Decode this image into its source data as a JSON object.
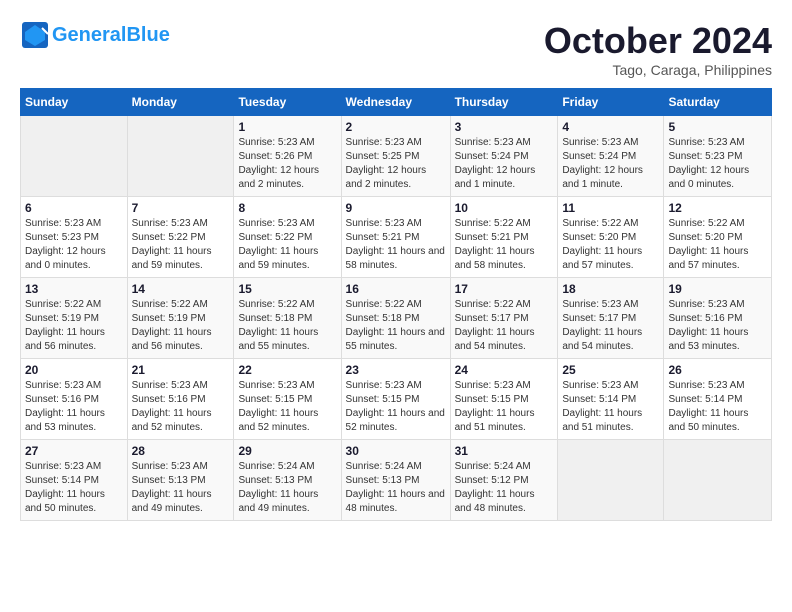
{
  "header": {
    "logo_text_part1": "General",
    "logo_text_part2": "Blue",
    "month": "October 2024",
    "location": "Tago, Caraga, Philippines"
  },
  "columns": [
    "Sunday",
    "Monday",
    "Tuesday",
    "Wednesday",
    "Thursday",
    "Friday",
    "Saturday"
  ],
  "weeks": [
    [
      {
        "day": "",
        "info": ""
      },
      {
        "day": "",
        "info": ""
      },
      {
        "day": "1",
        "info": "Sunrise: 5:23 AM\nSunset: 5:26 PM\nDaylight: 12 hours and 2 minutes."
      },
      {
        "day": "2",
        "info": "Sunrise: 5:23 AM\nSunset: 5:25 PM\nDaylight: 12 hours and 2 minutes."
      },
      {
        "day": "3",
        "info": "Sunrise: 5:23 AM\nSunset: 5:24 PM\nDaylight: 12 hours and 1 minute."
      },
      {
        "day": "4",
        "info": "Sunrise: 5:23 AM\nSunset: 5:24 PM\nDaylight: 12 hours and 1 minute."
      },
      {
        "day": "5",
        "info": "Sunrise: 5:23 AM\nSunset: 5:23 PM\nDaylight: 12 hours and 0 minutes."
      }
    ],
    [
      {
        "day": "6",
        "info": "Sunrise: 5:23 AM\nSunset: 5:23 PM\nDaylight: 12 hours and 0 minutes."
      },
      {
        "day": "7",
        "info": "Sunrise: 5:23 AM\nSunset: 5:22 PM\nDaylight: 11 hours and 59 minutes."
      },
      {
        "day": "8",
        "info": "Sunrise: 5:23 AM\nSunset: 5:22 PM\nDaylight: 11 hours and 59 minutes."
      },
      {
        "day": "9",
        "info": "Sunrise: 5:23 AM\nSunset: 5:21 PM\nDaylight: 11 hours and 58 minutes."
      },
      {
        "day": "10",
        "info": "Sunrise: 5:22 AM\nSunset: 5:21 PM\nDaylight: 11 hours and 58 minutes."
      },
      {
        "day": "11",
        "info": "Sunrise: 5:22 AM\nSunset: 5:20 PM\nDaylight: 11 hours and 57 minutes."
      },
      {
        "day": "12",
        "info": "Sunrise: 5:22 AM\nSunset: 5:20 PM\nDaylight: 11 hours and 57 minutes."
      }
    ],
    [
      {
        "day": "13",
        "info": "Sunrise: 5:22 AM\nSunset: 5:19 PM\nDaylight: 11 hours and 56 minutes."
      },
      {
        "day": "14",
        "info": "Sunrise: 5:22 AM\nSunset: 5:19 PM\nDaylight: 11 hours and 56 minutes."
      },
      {
        "day": "15",
        "info": "Sunrise: 5:22 AM\nSunset: 5:18 PM\nDaylight: 11 hours and 55 minutes."
      },
      {
        "day": "16",
        "info": "Sunrise: 5:22 AM\nSunset: 5:18 PM\nDaylight: 11 hours and 55 minutes."
      },
      {
        "day": "17",
        "info": "Sunrise: 5:22 AM\nSunset: 5:17 PM\nDaylight: 11 hours and 54 minutes."
      },
      {
        "day": "18",
        "info": "Sunrise: 5:23 AM\nSunset: 5:17 PM\nDaylight: 11 hours and 54 minutes."
      },
      {
        "day": "19",
        "info": "Sunrise: 5:23 AM\nSunset: 5:16 PM\nDaylight: 11 hours and 53 minutes."
      }
    ],
    [
      {
        "day": "20",
        "info": "Sunrise: 5:23 AM\nSunset: 5:16 PM\nDaylight: 11 hours and 53 minutes."
      },
      {
        "day": "21",
        "info": "Sunrise: 5:23 AM\nSunset: 5:16 PM\nDaylight: 11 hours and 52 minutes."
      },
      {
        "day": "22",
        "info": "Sunrise: 5:23 AM\nSunset: 5:15 PM\nDaylight: 11 hours and 52 minutes."
      },
      {
        "day": "23",
        "info": "Sunrise: 5:23 AM\nSunset: 5:15 PM\nDaylight: 11 hours and 52 minutes."
      },
      {
        "day": "24",
        "info": "Sunrise: 5:23 AM\nSunset: 5:15 PM\nDaylight: 11 hours and 51 minutes."
      },
      {
        "day": "25",
        "info": "Sunrise: 5:23 AM\nSunset: 5:14 PM\nDaylight: 11 hours and 51 minutes."
      },
      {
        "day": "26",
        "info": "Sunrise: 5:23 AM\nSunset: 5:14 PM\nDaylight: 11 hours and 50 minutes."
      }
    ],
    [
      {
        "day": "27",
        "info": "Sunrise: 5:23 AM\nSunset: 5:14 PM\nDaylight: 11 hours and 50 minutes."
      },
      {
        "day": "28",
        "info": "Sunrise: 5:23 AM\nSunset: 5:13 PM\nDaylight: 11 hours and 49 minutes."
      },
      {
        "day": "29",
        "info": "Sunrise: 5:24 AM\nSunset: 5:13 PM\nDaylight: 11 hours and 49 minutes."
      },
      {
        "day": "30",
        "info": "Sunrise: 5:24 AM\nSunset: 5:13 PM\nDaylight: 11 hours and 48 minutes."
      },
      {
        "day": "31",
        "info": "Sunrise: 5:24 AM\nSunset: 5:12 PM\nDaylight: 11 hours and 48 minutes."
      },
      {
        "day": "",
        "info": ""
      },
      {
        "day": "",
        "info": ""
      }
    ]
  ]
}
